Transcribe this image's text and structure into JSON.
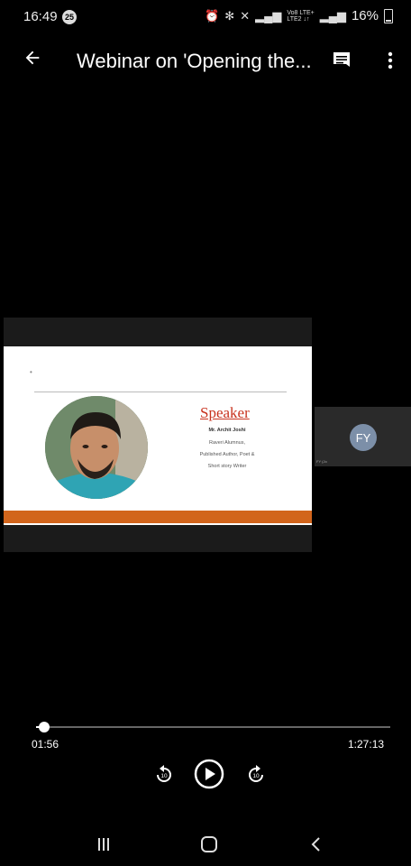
{
  "status": {
    "time": "16:49",
    "notif_count": "25",
    "battery": "16%",
    "net_top": "Vo8 LTE+",
    "net_bottom": "LTE2 ↓↑"
  },
  "header": {
    "title": "Webinar on 'Opening the...",
    "back_icon": "arrow-left-icon",
    "chat_icon": "chat-icon",
    "more_icon": "more-vert-icon"
  },
  "slide": {
    "heading": "Speaker",
    "name": "Mr. Archit Joshi",
    "lines": [
      "Raveri Alumnus,",
      "Published Author, Poet &",
      "Short story Writer"
    ],
    "accent": "#d2651c"
  },
  "participant": {
    "initials": "FY",
    "label": "FY (Jo"
  },
  "player": {
    "current": "01:56",
    "total": "1:27:13",
    "progress": 0.022
  },
  "nav": {
    "recents": "recents-icon",
    "home": "home-icon",
    "back": "back-icon"
  }
}
